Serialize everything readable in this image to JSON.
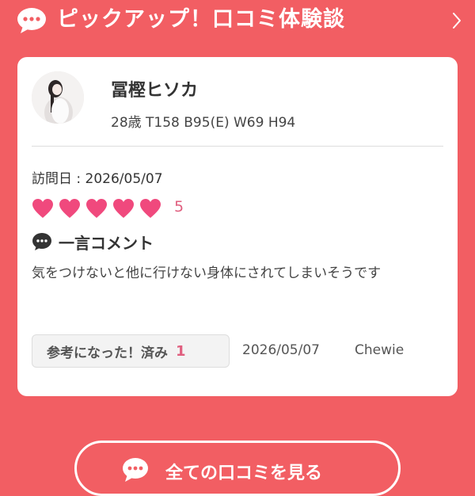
{
  "header": {
    "title": "ピックアップ！口コミ体験談",
    "icon": "speech-bubble-icon",
    "nav_icon": "chevron-right-icon"
  },
  "review": {
    "name": "冨樫ヒソカ",
    "stats": "28歳  T158  B95(E)  W69  H94",
    "visit_date": "訪問日 : 2026/05/07",
    "rating": {
      "hearts_filled": 5,
      "hearts_total": 5,
      "value": "5"
    },
    "comment_title": "一言コメント",
    "comment": "気をつけないと他に行けない身体にされてしまいそうです",
    "helpful_label": "参考になった！済み",
    "helpful_count": "1",
    "posted_date": "2026/05/07",
    "reviewer": "Chewie"
  },
  "footer": {
    "all_reviews_label": "全ての口コミを見る"
  },
  "colors": {
    "background": "#f25e63",
    "accent": "#e05f7f",
    "heart": "#f0497d"
  }
}
